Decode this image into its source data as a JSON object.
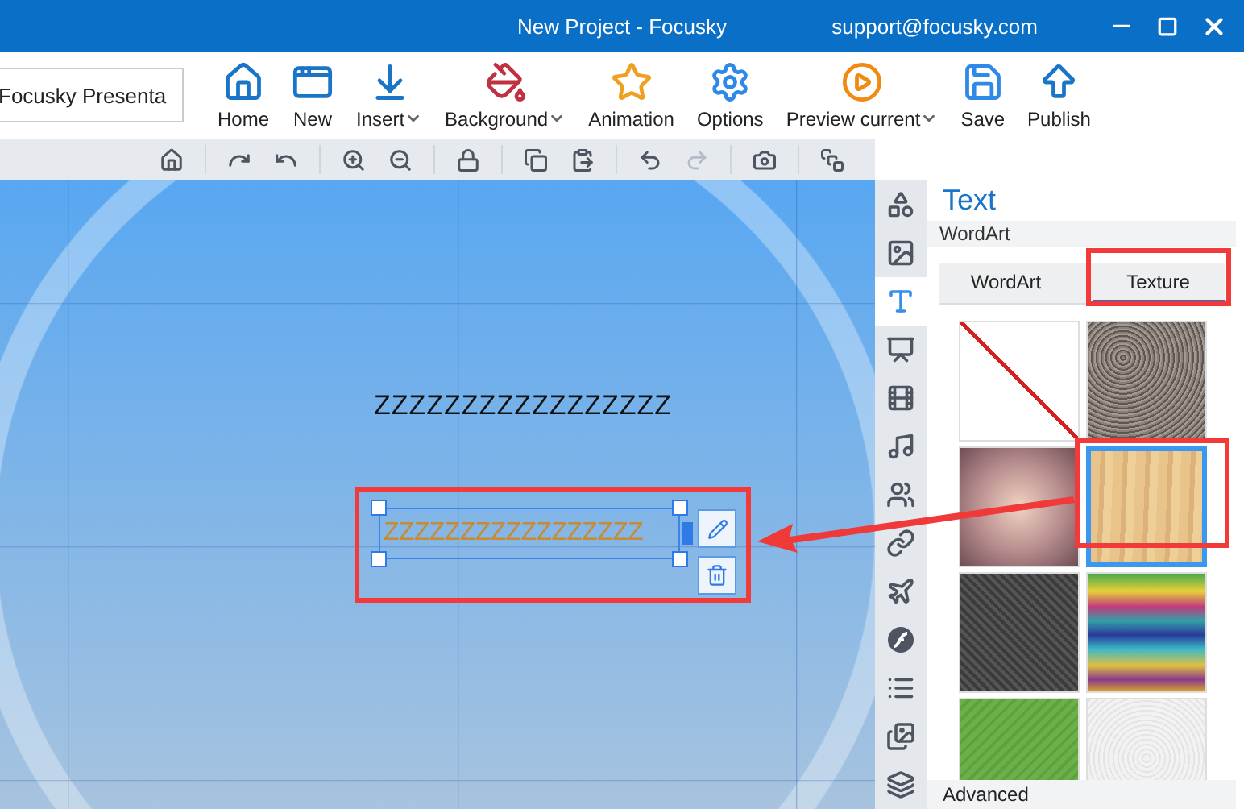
{
  "window": {
    "title": "New Project - Focusky",
    "support": "support@focusky.com"
  },
  "project_name": {
    "value": "Focusky Presenta"
  },
  "ribbon": [
    {
      "kind": "home",
      "label": "Home",
      "dropdown": false
    },
    {
      "kind": "new",
      "label": "New",
      "dropdown": false
    },
    {
      "kind": "insert",
      "label": "Insert",
      "dropdown": true
    },
    {
      "kind": "background",
      "label": "Background",
      "dropdown": true
    },
    {
      "kind": "animation",
      "label": "Animation",
      "dropdown": false
    },
    {
      "kind": "options",
      "label": "Options",
      "dropdown": false
    },
    {
      "kind": "preview",
      "label": "Preview current",
      "dropdown": true
    },
    {
      "kind": "save",
      "label": "Save",
      "dropdown": false
    },
    {
      "kind": "publish",
      "label": "Publish",
      "dropdown": false
    }
  ],
  "toolbar": [
    {
      "kind": "home",
      "disabled": false
    },
    {
      "kind": "redo-frame",
      "disabled": false
    },
    {
      "kind": "undo-frame",
      "disabled": false
    },
    {
      "kind": "zoom-in",
      "disabled": false
    },
    {
      "kind": "zoom-out",
      "disabled": false
    },
    {
      "kind": "lock",
      "disabled": false
    },
    {
      "kind": "copy",
      "disabled": false
    },
    {
      "kind": "paste",
      "disabled": false
    },
    {
      "kind": "undo",
      "disabled": false
    },
    {
      "kind": "redo",
      "disabled": true
    },
    {
      "kind": "camera",
      "disabled": false
    },
    {
      "kind": "window",
      "disabled": false
    }
  ],
  "side_strip": [
    {
      "kind": "shape",
      "selected": false
    },
    {
      "kind": "image",
      "selected": false
    },
    {
      "kind": "text",
      "selected": true
    },
    {
      "kind": "slide",
      "selected": false
    },
    {
      "kind": "video",
      "selected": false
    },
    {
      "kind": "music",
      "selected": false
    },
    {
      "kind": "people",
      "selected": false
    },
    {
      "kind": "link",
      "selected": false
    },
    {
      "kind": "plane",
      "selected": false
    },
    {
      "kind": "flash",
      "selected": false
    },
    {
      "kind": "list",
      "selected": false
    },
    {
      "kind": "gallery",
      "selected": false
    },
    {
      "kind": "layers",
      "selected": false
    }
  ],
  "canvas": {
    "text": "ZZZZZZZZZZZZZZZZZ",
    "selected_text": "ZZZZZZZZZZZZZZZZZ"
  },
  "panel": {
    "title": "Text",
    "section": "WordArt",
    "tabs": [
      {
        "label": "WordArt",
        "selected": false
      },
      {
        "label": "Texture",
        "selected": true
      }
    ],
    "textures": [
      {
        "kind": "none",
        "selected": false
      },
      {
        "kind": "gravel",
        "selected": false
      },
      {
        "kind": "blur",
        "selected": false
      },
      {
        "kind": "wood",
        "selected": true
      },
      {
        "kind": "carbon",
        "selected": false
      },
      {
        "kind": "rainbow",
        "selected": false
      },
      {
        "kind": "green",
        "selected": false
      },
      {
        "kind": "paper",
        "selected": false
      }
    ],
    "footer": "Advanced"
  }
}
